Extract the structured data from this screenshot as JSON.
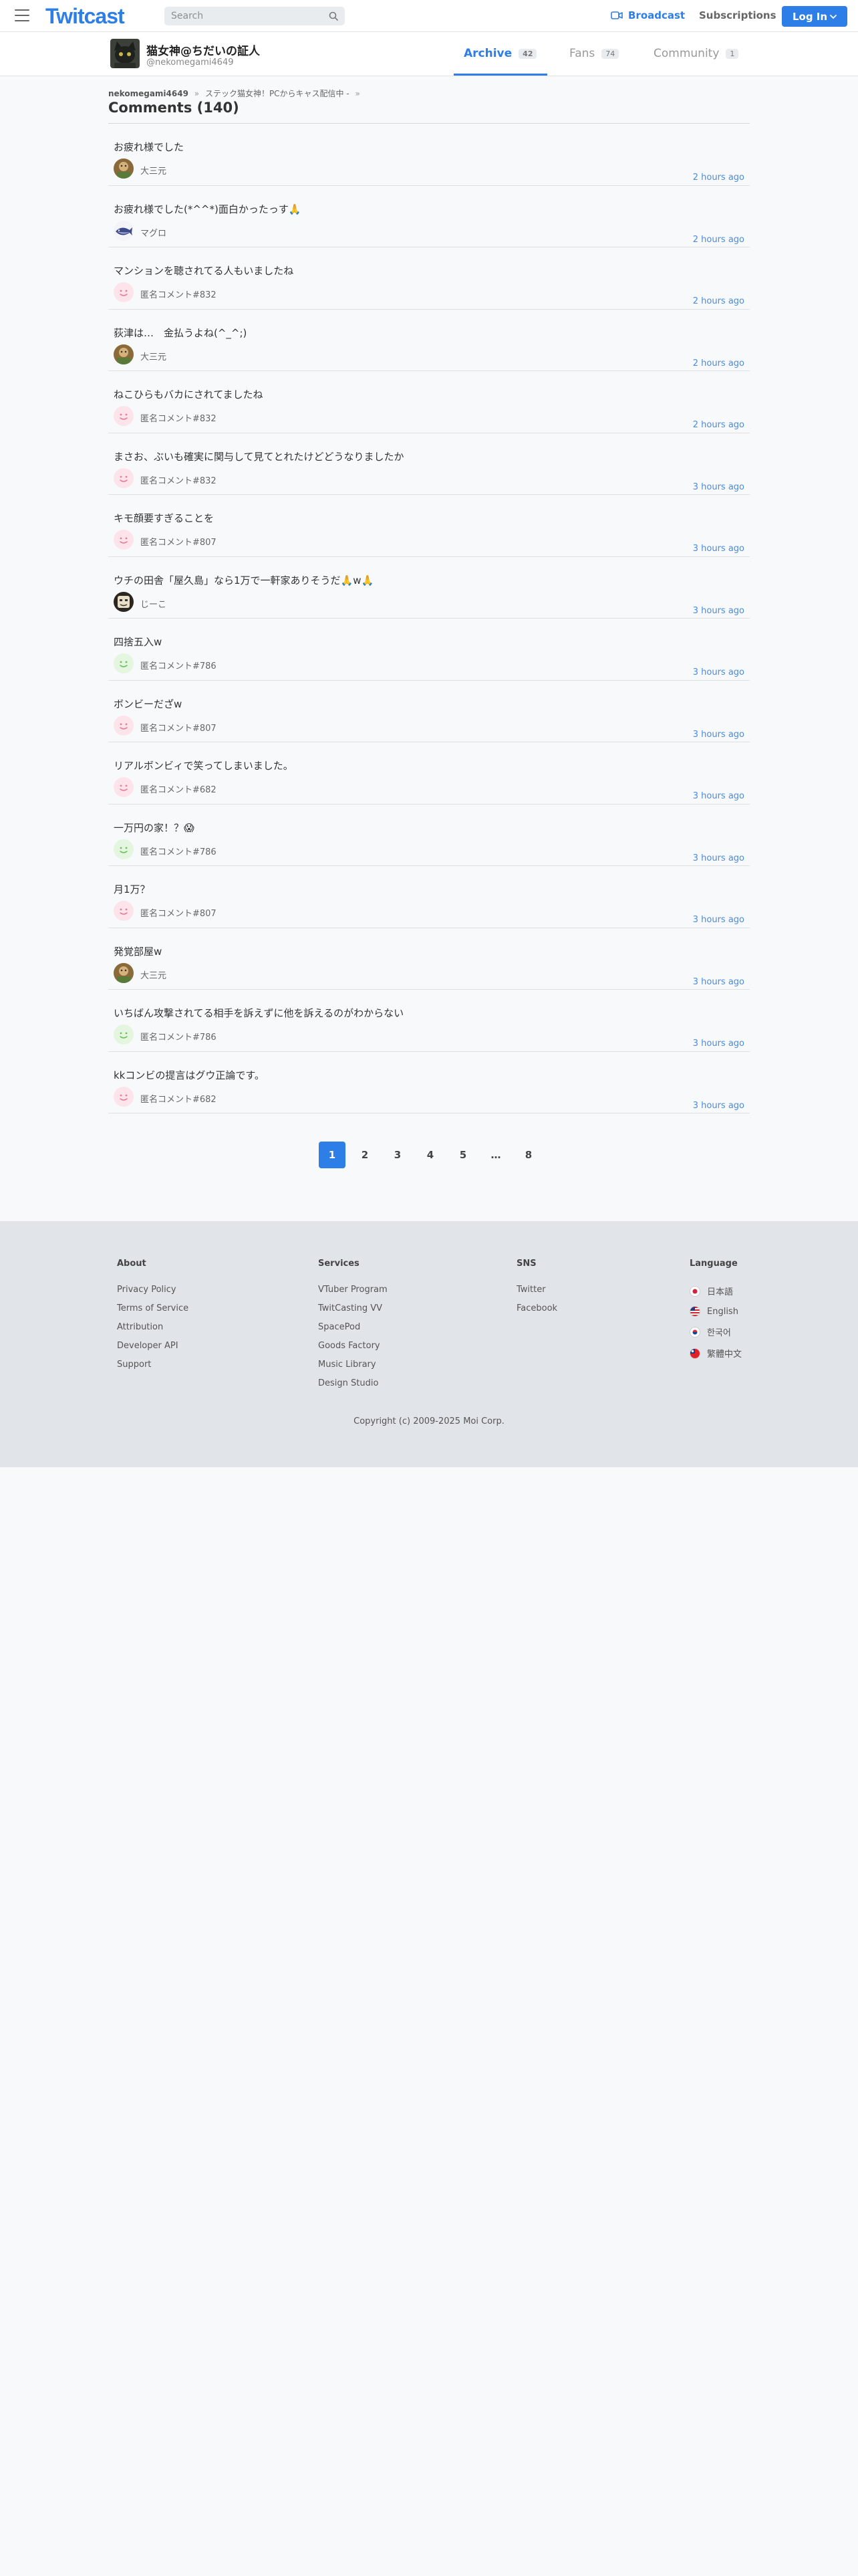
{
  "header": {
    "logo": "Twitcast",
    "search_placeholder": "Search",
    "broadcast_label": "Broadcast",
    "subscriptions_label": "Subscriptions",
    "login_label": "Log In"
  },
  "profile": {
    "name": "猫女神@ちだいの証人",
    "handle": "@nekomegami4649",
    "tabs": [
      {
        "label": "Archive",
        "count": "42"
      },
      {
        "label": "Fans",
        "count": "74"
      },
      {
        "label": "Community",
        "count": "1"
      }
    ]
  },
  "breadcrumb": {
    "user": "nekomegami4649",
    "title": "ステック猫女神！PCからキャス配信中 -"
  },
  "page_title": "Comments (140)",
  "comments": [
    {
      "text": "お疲れ様でした",
      "user": "大三元",
      "time": "2 hours ago",
      "avatar": "photo"
    },
    {
      "text": "お疲れ様でした(*^^*)面白かったっす🙏",
      "user": "マグロ",
      "time": "2 hours ago",
      "avatar": "tuna"
    },
    {
      "text": "マンションを聴されてる人もいましたね",
      "user": "匿名コメント#832",
      "time": "2 hours ago",
      "avatar": "anon-pink"
    },
    {
      "text": "荻津は…　金払うよね(^_^;)",
      "user": "大三元",
      "time": "2 hours ago",
      "avatar": "photo"
    },
    {
      "text": "ねこひらもバカにされてましたね",
      "user": "匿名コメント#832",
      "time": "2 hours ago",
      "avatar": "anon-pink"
    },
    {
      "text": "まさお、ぶいも確実に関与して見てとれたけどどうなりましたか",
      "user": "匿名コメント#832",
      "time": "3 hours ago",
      "avatar": "anon-pink"
    },
    {
      "text": "キモ顔要すぎることを",
      "user": "匿名コメント#807",
      "time": "3 hours ago",
      "avatar": "anon-pink"
    },
    {
      "text": "ウチの田舎「屋久島」なら1万で一軒家ありそうだ🙏w🙏",
      "user": "じーこ",
      "time": "3 hours ago",
      "avatar": "jiko"
    },
    {
      "text": "四捨五入w",
      "user": "匿名コメント#786",
      "time": "3 hours ago",
      "avatar": "anon-green"
    },
    {
      "text": "ボンビーだざw",
      "user": "匿名コメント#807",
      "time": "3 hours ago",
      "avatar": "anon-pink"
    },
    {
      "text": "リアルボンビィで笑ってしまいました。",
      "user": "匿名コメント#682",
      "time": "3 hours ago",
      "avatar": "anon-pink"
    },
    {
      "text": "一万円の家！？😱",
      "user": "匿名コメント#786",
      "time": "3 hours ago",
      "avatar": "anon-green"
    },
    {
      "text": "月1万？",
      "user": "匿名コメント#807",
      "time": "3 hours ago",
      "avatar": "anon-pink"
    },
    {
      "text": "発覚部屋w",
      "user": "大三元",
      "time": "3 hours ago",
      "avatar": "photo"
    },
    {
      "text": "いちばん攻撃されてる相手を訴えずに他を訴えるのがわからない",
      "user": "匿名コメント#786",
      "time": "3 hours ago",
      "avatar": "anon-green"
    },
    {
      "text": "kkコンビの提言はグウ正論です。",
      "user": "匿名コメント#682",
      "time": "3 hours ago",
      "avatar": "anon-pink"
    }
  ],
  "pagination": [
    "1",
    "2",
    "3",
    "4",
    "5",
    "…",
    "8"
  ],
  "footer": {
    "about": {
      "title": "About",
      "links": [
        "Privacy Policy",
        "Terms of Service",
        "Attribution",
        "Developer API",
        "Support"
      ]
    },
    "services": {
      "title": "Services",
      "links": [
        "VTuber Program",
        "TwitCasting VV",
        "SpacePod",
        "Goods Factory",
        "Music Library",
        "Design Studio"
      ]
    },
    "sns": {
      "title": "SNS",
      "links": [
        "Twitter",
        "Facebook"
      ]
    },
    "language": {
      "title": "Language",
      "links": [
        "日本語",
        "English",
        "한국어",
        "繁體中文"
      ]
    },
    "copyright": "Copyright (c) 2009-2025 Moi Corp."
  },
  "colors": {
    "accent": "#2d7ee6",
    "time": "#4a8cde",
    "footer_bg": "#e1e4e8"
  }
}
